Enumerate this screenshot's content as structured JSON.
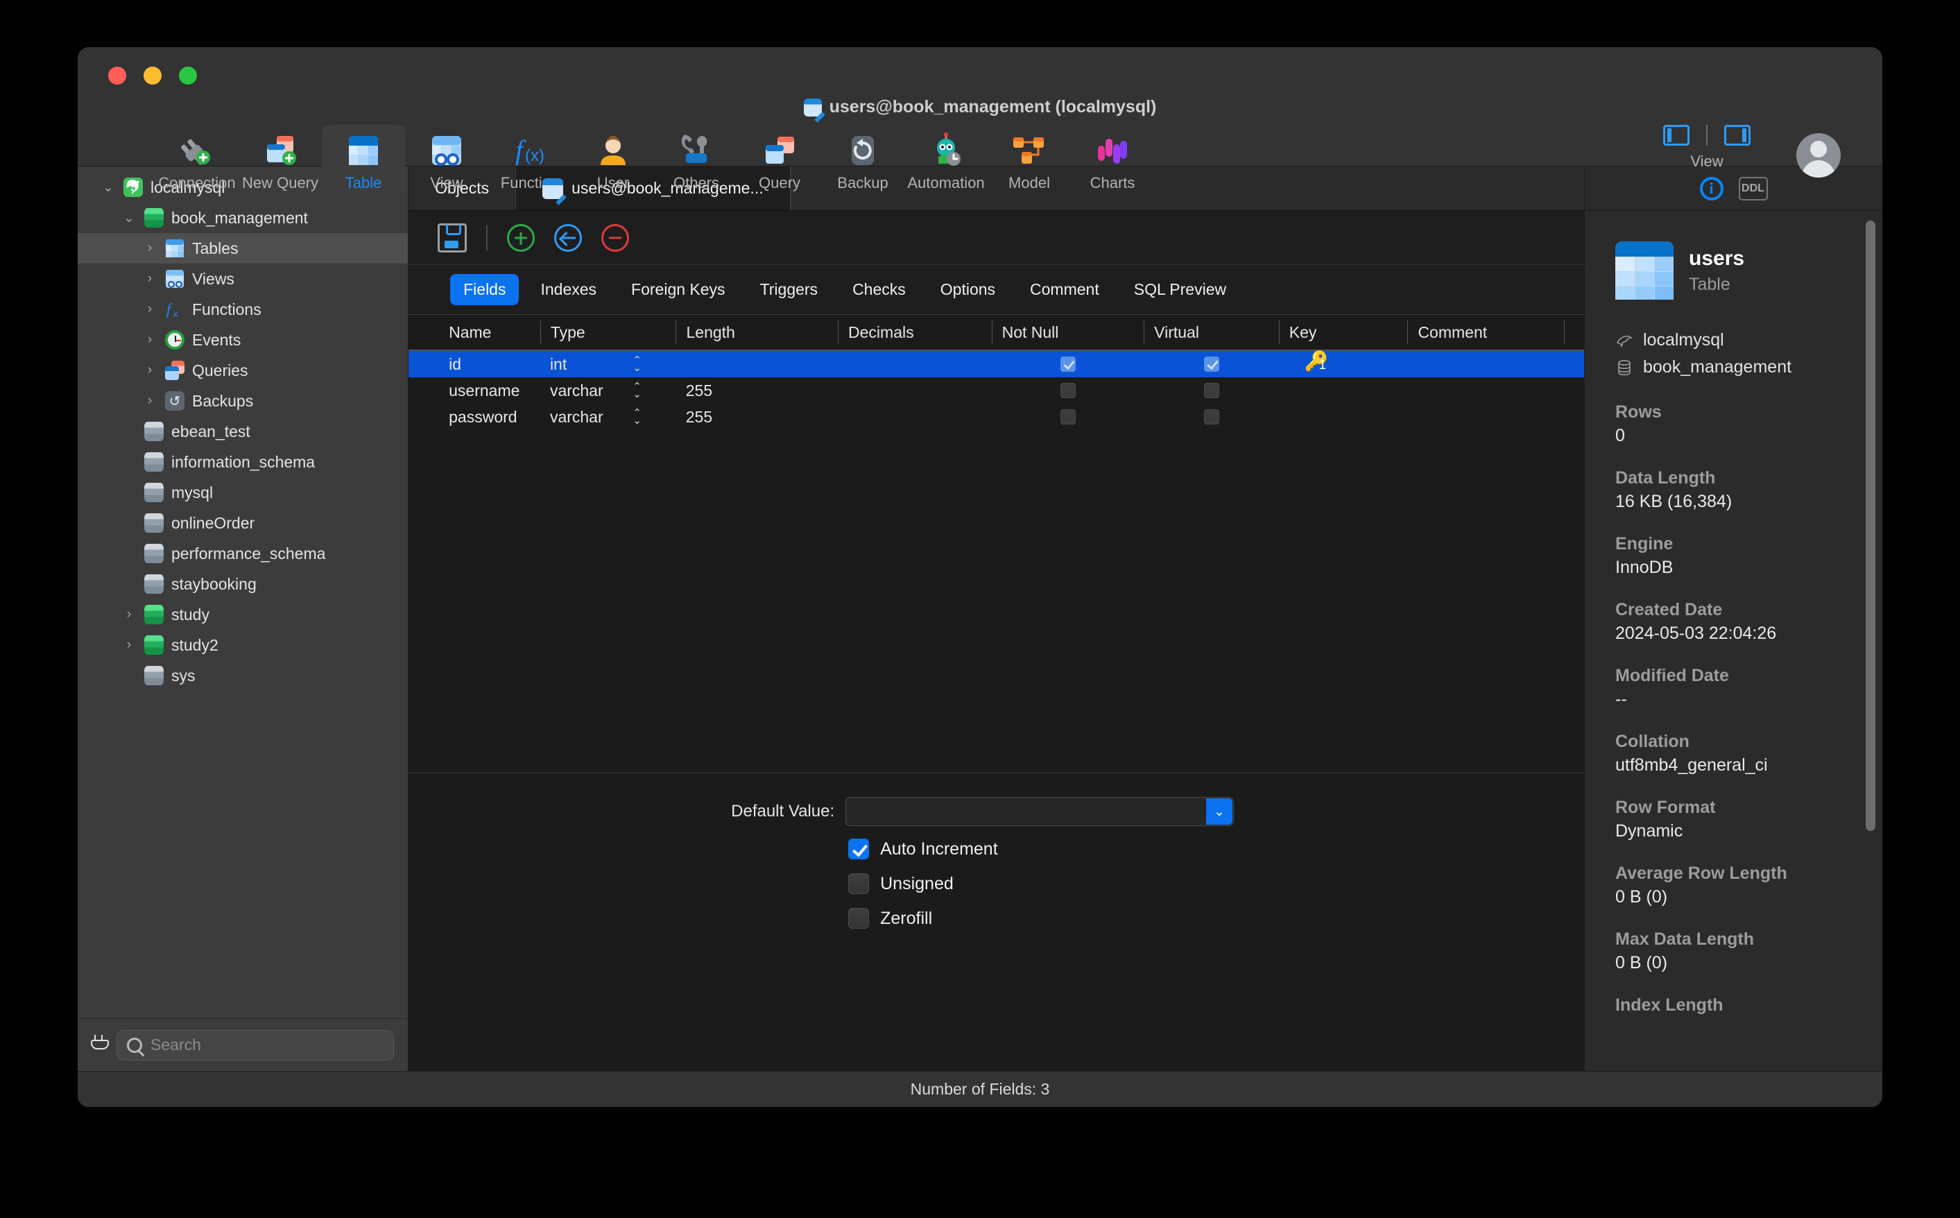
{
  "window": {
    "title": "users@book_management (localmysql)",
    "title_icon": "table-edit-icon"
  },
  "toolbar": {
    "items": [
      {
        "label": "Connection",
        "icon": "connection-icon"
      },
      {
        "label": "New Query",
        "icon": "new-query-icon"
      },
      {
        "label": "Table",
        "icon": "table-icon",
        "active": true
      },
      {
        "label": "View",
        "icon": "view-icon"
      },
      {
        "label": "Function",
        "icon": "function-icon"
      },
      {
        "label": "User",
        "icon": "user-icon"
      },
      {
        "label": "Others",
        "icon": "others-icon"
      },
      {
        "label": "Query",
        "icon": "query-icon"
      },
      {
        "label": "Backup",
        "icon": "backup-icon"
      },
      {
        "label": "Automation",
        "icon": "automation-icon"
      },
      {
        "label": "Model",
        "icon": "model-icon"
      },
      {
        "label": "Charts",
        "icon": "charts-icon"
      }
    ],
    "view_label": "View"
  },
  "sidebar": {
    "tree": [
      {
        "label": "localmysql",
        "icon": "mysql-dolphin-icon",
        "indent": 0,
        "twisty": "down"
      },
      {
        "label": "book_management",
        "icon": "database-green-icon",
        "indent": 1,
        "twisty": "down"
      },
      {
        "label": "Tables",
        "icon": "tables-icon",
        "indent": 2,
        "twisty": "right",
        "selected": true
      },
      {
        "label": "Views",
        "icon": "views-icon",
        "indent": 2,
        "twisty": "right"
      },
      {
        "label": "Functions",
        "icon": "functions-icon",
        "indent": 2,
        "twisty": "right"
      },
      {
        "label": "Events",
        "icon": "events-clock-icon",
        "indent": 2,
        "twisty": "right"
      },
      {
        "label": "Queries",
        "icon": "queries-icon",
        "indent": 2,
        "twisty": "right"
      },
      {
        "label": "Backups",
        "icon": "backups-icon",
        "indent": 2,
        "twisty": "right"
      },
      {
        "label": "ebean_test",
        "icon": "database-gray-icon",
        "indent": 1,
        "twisty": "none"
      },
      {
        "label": "information_schema",
        "icon": "database-gray-icon",
        "indent": 1,
        "twisty": "none"
      },
      {
        "label": "mysql",
        "icon": "database-gray-icon",
        "indent": 1,
        "twisty": "none"
      },
      {
        "label": "onlineOrder",
        "icon": "database-gray-icon",
        "indent": 1,
        "twisty": "none"
      },
      {
        "label": "performance_schema",
        "icon": "database-gray-icon",
        "indent": 1,
        "twisty": "none"
      },
      {
        "label": "staybooking",
        "icon": "database-gray-icon",
        "indent": 1,
        "twisty": "none"
      },
      {
        "label": "study",
        "icon": "database-green-icon",
        "indent": 1,
        "twisty": "right"
      },
      {
        "label": "study2",
        "icon": "database-green-icon",
        "indent": 1,
        "twisty": "right"
      },
      {
        "label": "sys",
        "icon": "database-gray-icon",
        "indent": 1,
        "twisty": "none"
      }
    ],
    "search_placeholder": "Search"
  },
  "tabs": [
    {
      "label": "Objects",
      "active": false,
      "icon": null
    },
    {
      "label": "users@book_manageme...",
      "active": true,
      "icon": "table-edit-icon"
    }
  ],
  "action_toolbar": {
    "save": "save-icon",
    "add_field": "add-circle-icon",
    "insert_field": "insert-circle-icon",
    "delete_field": "delete-circle-icon"
  },
  "sub_tabs": [
    {
      "label": "Fields",
      "active": true
    },
    {
      "label": "Indexes",
      "active": false
    },
    {
      "label": "Foreign Keys",
      "active": false
    },
    {
      "label": "Triggers",
      "active": false
    },
    {
      "label": "Checks",
      "active": false
    },
    {
      "label": "Options",
      "active": false
    },
    {
      "label": "Comment",
      "active": false
    },
    {
      "label": "SQL Preview",
      "active": false
    }
  ],
  "fields_grid": {
    "columns": [
      "Name",
      "Type",
      "Length",
      "Decimals",
      "Not Null",
      "Virtual",
      "Key",
      "Comment"
    ],
    "rows": [
      {
        "name": "id",
        "type": "int",
        "length": "",
        "decimals": "",
        "not_null": true,
        "virtual": false,
        "key": "1",
        "comment": "",
        "selected": true
      },
      {
        "name": "username",
        "type": "varchar",
        "length": "255",
        "decimals": "",
        "not_null": false,
        "virtual": false,
        "key": "",
        "comment": "",
        "selected": false
      },
      {
        "name": "password",
        "type": "varchar",
        "length": "255",
        "decimals": "",
        "not_null": false,
        "virtual": false,
        "key": "",
        "comment": "",
        "selected": false
      }
    ]
  },
  "field_details": {
    "default_value_label": "Default Value:",
    "default_value": "",
    "checkboxes": [
      {
        "label": "Auto Increment",
        "checked": true
      },
      {
        "label": "Unsigned",
        "checked": false
      },
      {
        "label": "Zerofill",
        "checked": false
      }
    ]
  },
  "info_panel": {
    "info_tab": "i",
    "ddl_tab": "DDL",
    "object_name": "users",
    "object_type": "Table",
    "connection": "localmysql",
    "database": "book_management",
    "properties": [
      {
        "key": "Rows",
        "value": "0"
      },
      {
        "key": "Data Length",
        "value": "16 KB (16,384)"
      },
      {
        "key": "Engine",
        "value": "InnoDB"
      },
      {
        "key": "Created Date",
        "value": "2024-05-03 22:04:26"
      },
      {
        "key": "Modified Date",
        "value": "--"
      },
      {
        "key": "Collation",
        "value": "utf8mb4_general_ci"
      },
      {
        "key": "Row Format",
        "value": "Dynamic"
      },
      {
        "key": "Average Row Length",
        "value": "0 B (0)"
      },
      {
        "key": "Max Data Length",
        "value": "0 B (0)"
      },
      {
        "key": "Index Length",
        "value": ""
      }
    ]
  },
  "status_bar": {
    "text": "Number of Fields: 3"
  }
}
